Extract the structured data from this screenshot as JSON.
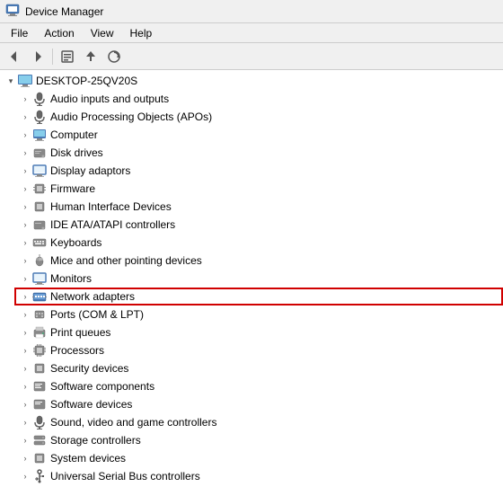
{
  "titleBar": {
    "icon": "computer-icon",
    "title": "Device Manager"
  },
  "menuBar": {
    "items": [
      {
        "id": "file",
        "label": "File"
      },
      {
        "id": "action",
        "label": "Action"
      },
      {
        "id": "view",
        "label": "View"
      },
      {
        "id": "help",
        "label": "Help"
      }
    ]
  },
  "toolbar": {
    "buttons": [
      {
        "id": "back",
        "icon": "◄",
        "label": "Back"
      },
      {
        "id": "forward",
        "icon": "►",
        "label": "Forward"
      },
      {
        "id": "properties",
        "icon": "⊟",
        "label": "Properties"
      },
      {
        "id": "update",
        "icon": "↑",
        "label": "Update Driver"
      },
      {
        "id": "scan",
        "icon": "⟳",
        "label": "Scan for hardware changes"
      }
    ]
  },
  "treeRoot": {
    "label": "DESKTOP-25QV20S",
    "expanded": true,
    "items": [
      {
        "id": "audio-inputs",
        "label": "Audio inputs and outputs",
        "icon": "speaker",
        "expanded": false
      },
      {
        "id": "audio-apo",
        "label": "Audio Processing Objects (APOs)",
        "icon": "speaker",
        "expanded": false
      },
      {
        "id": "computer",
        "label": "Computer",
        "icon": "computer",
        "expanded": false
      },
      {
        "id": "disk-drives",
        "label": "Disk drives",
        "icon": "disk",
        "expanded": false
      },
      {
        "id": "display",
        "label": "Display adaptors",
        "icon": "monitor",
        "expanded": false
      },
      {
        "id": "firmware",
        "label": "Firmware",
        "icon": "chip",
        "expanded": false
      },
      {
        "id": "hid",
        "label": "Human Interface Devices",
        "icon": "chip",
        "expanded": false
      },
      {
        "id": "ide",
        "label": "IDE ATA/ATAPI controllers",
        "icon": "disk",
        "expanded": false
      },
      {
        "id": "keyboards",
        "label": "Keyboards",
        "icon": "keyboard",
        "expanded": false
      },
      {
        "id": "mice",
        "label": "Mice and other pointing devices",
        "icon": "mouse",
        "expanded": false
      },
      {
        "id": "monitors",
        "label": "Monitors",
        "icon": "monitor",
        "expanded": false
      },
      {
        "id": "network",
        "label": "Network adapters",
        "icon": "network",
        "expanded": false,
        "highlighted": true
      },
      {
        "id": "ports",
        "label": "Ports (COM & LPT)",
        "icon": "chip",
        "expanded": false
      },
      {
        "id": "print",
        "label": "Print queues",
        "icon": "print",
        "expanded": false
      },
      {
        "id": "processors",
        "label": "Processors",
        "icon": "cpu",
        "expanded": false
      },
      {
        "id": "security",
        "label": "Security devices",
        "icon": "security",
        "expanded": false
      },
      {
        "id": "software-comp",
        "label": "Software components",
        "icon": "chip",
        "expanded": false
      },
      {
        "id": "software-dev",
        "label": "Software devices",
        "icon": "chip",
        "expanded": false
      },
      {
        "id": "sound",
        "label": "Sound, video and game controllers",
        "icon": "speaker",
        "expanded": false
      },
      {
        "id": "storage",
        "label": "Storage controllers",
        "icon": "storage",
        "expanded": false
      },
      {
        "id": "system",
        "label": "System devices",
        "icon": "chip",
        "expanded": false
      },
      {
        "id": "usb",
        "label": "Universal Serial Bus controllers",
        "icon": "usb",
        "expanded": false
      }
    ]
  }
}
